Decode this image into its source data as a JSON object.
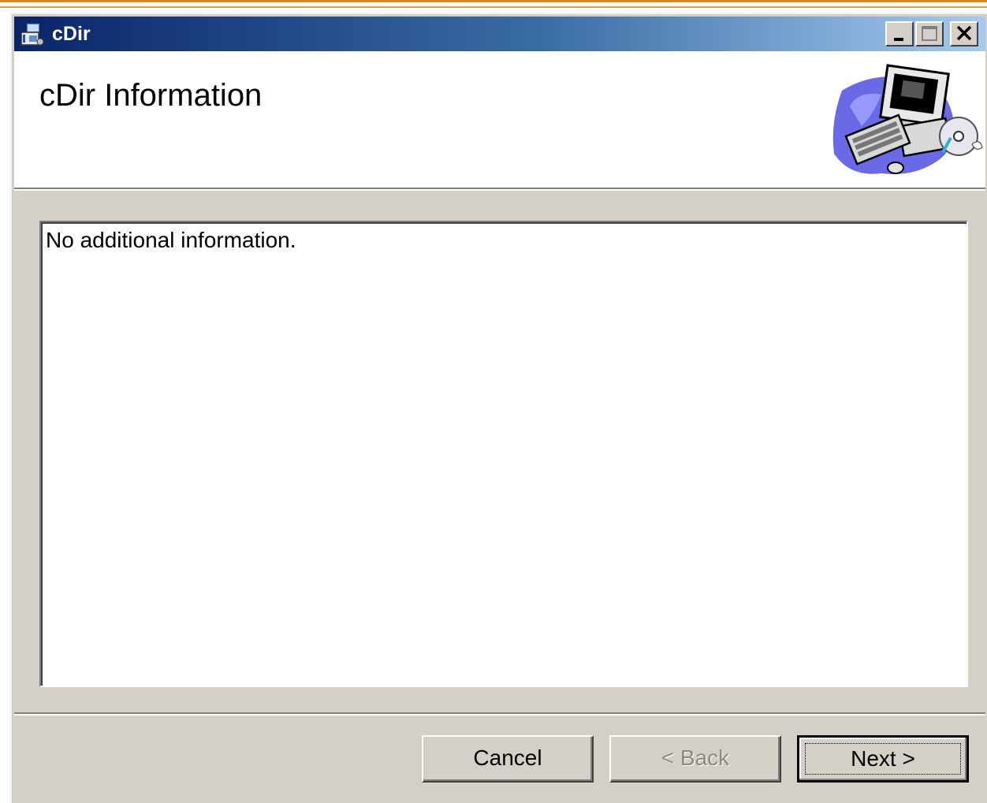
{
  "window": {
    "title": "cDir",
    "controls": {
      "minimize": "minimize-icon",
      "maximize": "maximize-icon",
      "close": "close-icon"
    }
  },
  "header": {
    "title": "cDir Information",
    "art_icon": "computer-setup-icon"
  },
  "content": {
    "info_text": "No additional information."
  },
  "buttons": {
    "cancel_label": "Cancel",
    "back_label": "< Back",
    "next_label": "Next >"
  },
  "colors": {
    "titlebar_start": "#0a246a",
    "titlebar_end": "#a6caf0",
    "dialog_face": "#d4d0c8"
  }
}
